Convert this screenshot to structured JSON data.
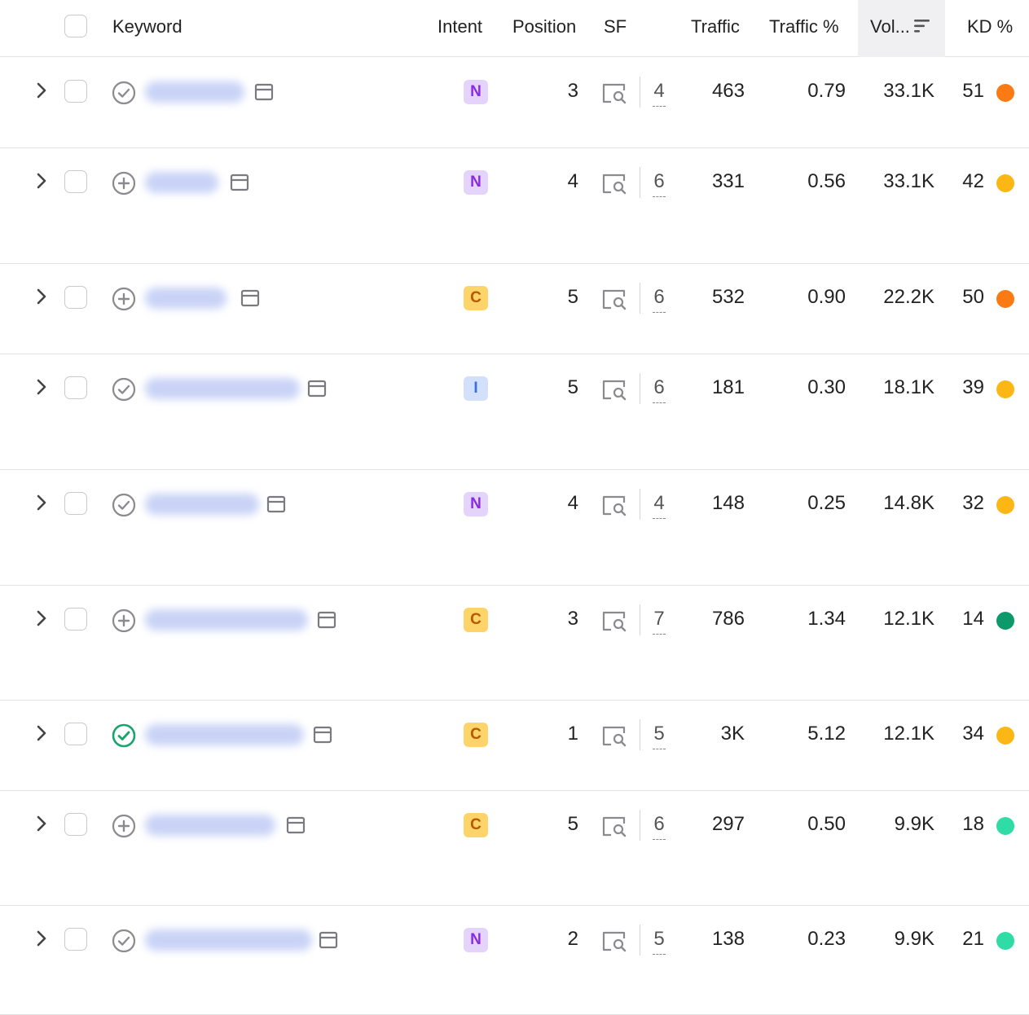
{
  "header": {
    "keyword": "Keyword",
    "intent": "Intent",
    "position": "Position",
    "sf": "SF",
    "traffic": "Traffic",
    "traffic_pct": "Traffic %",
    "volume": "Vol...",
    "kd": "KD %"
  },
  "colors": {
    "kd_orange": "#fb7a14",
    "kd_yellow": "#fdb714",
    "kd_dark_green": "#0d9a6a",
    "kd_light_green": "#2fdca6",
    "status_green": "#17a56b"
  },
  "rows": [
    {
      "status": "check-circle-icon",
      "intent": "N",
      "position": "3",
      "sf": "4",
      "traffic": "463",
      "traffic_pct": "0.79",
      "volume": "33.1K",
      "kd": "51",
      "kd_color": "#fb7a14"
    },
    {
      "status": "plus-circle-icon",
      "intent": "N",
      "position": "4",
      "sf": "6",
      "traffic": "331",
      "traffic_pct": "0.56",
      "volume": "33.1K",
      "kd": "42",
      "kd_color": "#fdb714"
    },
    {
      "status": "plus-circle-icon",
      "intent": "C",
      "position": "5",
      "sf": "6",
      "traffic": "532",
      "traffic_pct": "0.90",
      "volume": "22.2K",
      "kd": "50",
      "kd_color": "#fb7a14"
    },
    {
      "status": "check-circle-icon",
      "intent": "I",
      "position": "5",
      "sf": "6",
      "traffic": "181",
      "traffic_pct": "0.30",
      "volume": "18.1K",
      "kd": "39",
      "kd_color": "#fdb714"
    },
    {
      "status": "check-circle-icon",
      "intent": "N",
      "position": "4",
      "sf": "4",
      "traffic": "148",
      "traffic_pct": "0.25",
      "volume": "14.8K",
      "kd": "32",
      "kd_color": "#fdb714"
    },
    {
      "status": "plus-circle-icon",
      "intent": "C",
      "position": "3",
      "sf": "7",
      "traffic": "786",
      "traffic_pct": "1.34",
      "volume": "12.1K",
      "kd": "14",
      "kd_color": "#0d9a6a"
    },
    {
      "status": "check-circle-active-icon",
      "intent": "C",
      "position": "1",
      "sf": "5",
      "traffic": "3K",
      "traffic_pct": "5.12",
      "volume": "12.1K",
      "kd": "34",
      "kd_color": "#fdb714"
    },
    {
      "status": "plus-circle-icon",
      "intent": "C",
      "position": "5",
      "sf": "6",
      "traffic": "297",
      "traffic_pct": "0.50",
      "volume": "9.9K",
      "kd": "18",
      "kd_color": "#2fdca6"
    },
    {
      "status": "check-circle-icon",
      "intent": "N",
      "position": "2",
      "sf": "5",
      "traffic": "138",
      "traffic_pct": "0.23",
      "volume": "9.9K",
      "kd": "21",
      "kd_color": "#2fdca6"
    }
  ]
}
